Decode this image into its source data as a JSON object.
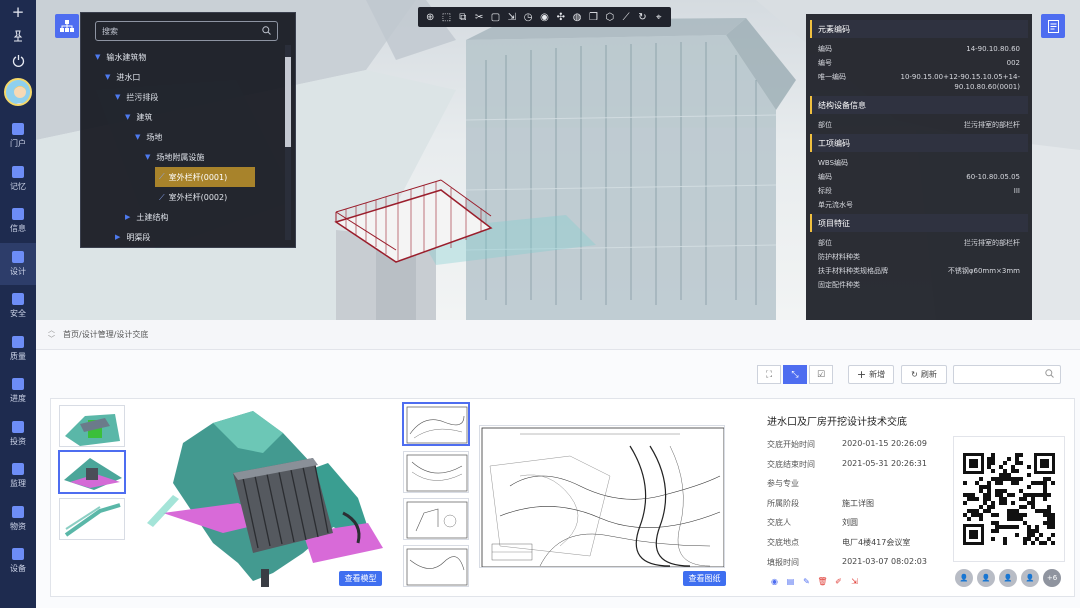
{
  "sidebar": {
    "top_icons": [
      "plus-icon",
      "pin-icon",
      "power-icon"
    ],
    "items": [
      {
        "label": "门户",
        "icon": "shield-icon"
      },
      {
        "label": "记忆",
        "icon": "link-icon"
      },
      {
        "label": "信息",
        "icon": "doc-icon"
      },
      {
        "label": "设计",
        "icon": "list-icon"
      },
      {
        "label": "安全",
        "icon": "shield-icon"
      },
      {
        "label": "质量",
        "icon": "shield-icon"
      },
      {
        "label": "进度",
        "icon": "bar-chart-icon"
      },
      {
        "label": "投资",
        "icon": "folder-icon"
      },
      {
        "label": "监理",
        "icon": "person-icon"
      },
      {
        "label": "物资",
        "icon": "cube-icon"
      },
      {
        "label": "设备",
        "icon": "doc-icon"
      }
    ],
    "active_index": 3
  },
  "tree": {
    "search_placeholder": "搜索",
    "nodes": [
      {
        "label": "输水建筑物",
        "level": 0,
        "arrow": "▼"
      },
      {
        "label": "进水口",
        "level": 1,
        "arrow": "▼"
      },
      {
        "label": "拦污排段",
        "level": 2,
        "arrow": "▼"
      },
      {
        "label": "建筑",
        "level": 3,
        "arrow": "▼"
      },
      {
        "label": "场地",
        "level": 4,
        "arrow": "▼"
      },
      {
        "label": "场地附属设施",
        "level": 5,
        "arrow": "▼"
      },
      {
        "label": "室外栏杆(0001)",
        "level": 6,
        "arrow": "",
        "selected": true
      },
      {
        "label": "室外栏杆(0002)",
        "level": 6,
        "arrow": ""
      },
      {
        "label": "土建结构",
        "level": 3,
        "arrow": "▶"
      },
      {
        "label": "明渠段",
        "level": 2,
        "arrow": "▶"
      }
    ]
  },
  "toolbar": {
    "icons": [
      "crosshair-icon",
      "select-icon",
      "frame-icon",
      "cut-icon",
      "box-icon",
      "export-icon",
      "clock-icon",
      "eye-icon",
      "explode-icon",
      "globe-icon",
      "layers-icon",
      "cube-icon",
      "measure-icon",
      "rotate-icon",
      "location-icon"
    ]
  },
  "properties": {
    "sections": [
      {
        "title": "元素编码",
        "rows": [
          {
            "k": "编码",
            "v": "14-90.10.80.60"
          },
          {
            "k": "编号",
            "v": "002"
          },
          {
            "k": "唯一编码",
            "v": "10-90.15.00+12-90.15.10.05+14-90.10.80.60(0001)"
          }
        ]
      },
      {
        "title": "结构设备信息",
        "rows": [
          {
            "k": "部位",
            "v": "拦污排室的部栏杆"
          }
        ]
      },
      {
        "title": "工项编码",
        "rows": [
          {
            "k": "WBS编码",
            "v": ""
          },
          {
            "k": "编码",
            "v": "60-10.80.05.05"
          },
          {
            "k": "标段",
            "v": "III"
          },
          {
            "k": "单元流水号",
            "v": ""
          }
        ]
      },
      {
        "title": "项目特征",
        "rows": [
          {
            "k": "部位",
            "v": "拦污排室的部栏杆"
          },
          {
            "k": "防护材料种类",
            "v": ""
          },
          {
            "k": "扶手材料种类规格品牌",
            "v": "不锈钢φ60mm×3mm"
          },
          {
            "k": "固定配件种类",
            "v": ""
          }
        ]
      }
    ]
  },
  "breadcrumb": {
    "text": "首页/设计管理/设计交底"
  },
  "actions": {
    "add_label": "新增",
    "refresh_label": "刷新",
    "search_placeholder": ""
  },
  "view_modes": [
    "fullscreen-icon",
    "collapse-icon",
    "check-icon"
  ],
  "record": {
    "title": "进水口及厂房开挖设计技术交底",
    "fields": [
      {
        "k": "交底开始时间",
        "v": "2020-01-15 20:26:09"
      },
      {
        "k": "交底结束时间",
        "v": "2021-05-31 20:26:31"
      },
      {
        "k": "参与专业",
        "v": ""
      },
      {
        "k": "所属阶段",
        "v": "施工详图"
      },
      {
        "k": "交底人",
        "v": "刘圆"
      },
      {
        "k": "交底地点",
        "v": "电厂4楼417会议室"
      },
      {
        "k": "填报时间",
        "v": "2021-03-07 08:02:03"
      }
    ],
    "view_model_label": "查看模型",
    "view_drawing_label": "查看图纸",
    "more_participants": "+6",
    "row_actions": [
      "eye-icon",
      "doc-icon",
      "edit-icon",
      "delete-icon",
      "doc-edit-icon",
      "export-icon"
    ]
  },
  "colors": {
    "accent": "#4e6df0",
    "sidebar_bg": "#1e2b4f",
    "highlight": "#a8832b",
    "panel_header_mark": "#f0c040",
    "danger": "#e0403a"
  }
}
